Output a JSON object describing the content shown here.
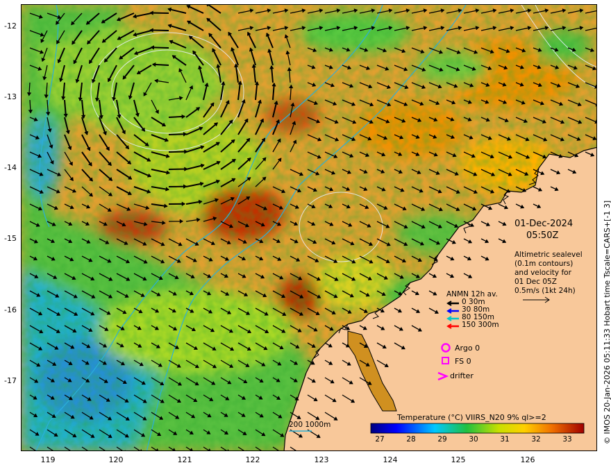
{
  "map": {
    "y_labels": [
      "-12",
      "-13",
      "-14",
      "-15",
      "-16",
      "-17"
    ],
    "x_labels": [
      "119",
      "120",
      "121",
      "122",
      "123",
      "124",
      "125",
      "126"
    ]
  },
  "header": {
    "date": "01-Dec-2024",
    "time": "05:50Z"
  },
  "altimetry": {
    "lines": [
      "Altimetric sealevel",
      "(0.1m contours)",
      "and velocity for",
      "01 Dec 05Z",
      "0.5m/s (1kt 24h)"
    ]
  },
  "anmn": {
    "title": "ANMN 12h av.",
    "items": [
      {
        "label": "0 30m",
        "color": "#000000"
      },
      {
        "label": "30 80m",
        "color": "#0000ff"
      },
      {
        "label": "80 150m",
        "color": "#00c8c8"
      },
      {
        "label": "150 300m",
        "color": "#ff0000"
      }
    ]
  },
  "markers": {
    "argo": "Argo 0",
    "fs": "FS 0",
    "drifter": "drifter",
    "marker_color": "#ff00ff"
  },
  "bathy": {
    "label": "200  1000m",
    "color": "#2ab0d8"
  },
  "colorbar": {
    "title": "Temperature (°C) VIIRS_N20 9% ql>=2",
    "ticks": [
      "27",
      "28",
      "29",
      "30",
      "31",
      "32",
      "33"
    ]
  },
  "credit": "© IMOS 20-Jan-2026 05:11:33 Hobart time Tscale=CARS+[-1 3]",
  "colors": {
    "land": "#f8c89a",
    "coast": "#000000"
  }
}
